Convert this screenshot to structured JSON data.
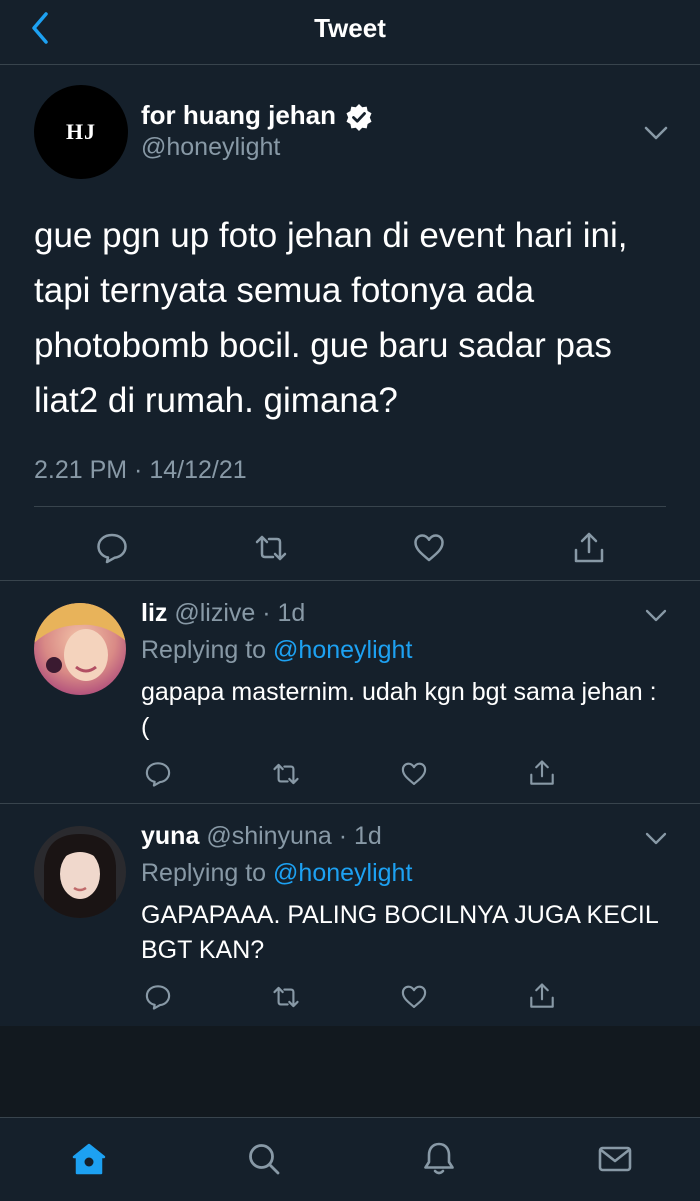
{
  "header": {
    "title": "Tweet",
    "back_icon": "chevron-left-icon",
    "accent": "#1da1f2"
  },
  "tweet": {
    "avatar_text": "HJ",
    "name": "for huang jehan",
    "handle": "@honeylight",
    "verified": true,
    "text": "gue pgn up foto jehan di event hari ini, tapi ternyata semua fotonya ada photobomb bocil. gue baru sadar pas liat2 di rumah. gimana?",
    "timestamp": "2.21 PM · 14/12/21"
  },
  "replies": [
    {
      "name": "liz",
      "handle": "@lizive",
      "age": "1d",
      "replying_label": "Replying to",
      "replying_to": "@honeylight",
      "text": "gapapa masternim. udah kgn bgt sama jehan :("
    },
    {
      "name": "yuna",
      "handle": "@shinyuna",
      "age": "1d",
      "replying_label": "Replying to",
      "replying_to": "@honeylight",
      "text": "GAPAPAAA. PALING BOCILNYA JUGA KECIL BGT KAN?"
    }
  ],
  "bottom_nav": [
    "home-icon",
    "search-icon",
    "notifications-icon",
    "messages-icon"
  ],
  "colors": {
    "background": "#15202b",
    "secondary_text": "#8899a6",
    "divider": "#38444d"
  }
}
